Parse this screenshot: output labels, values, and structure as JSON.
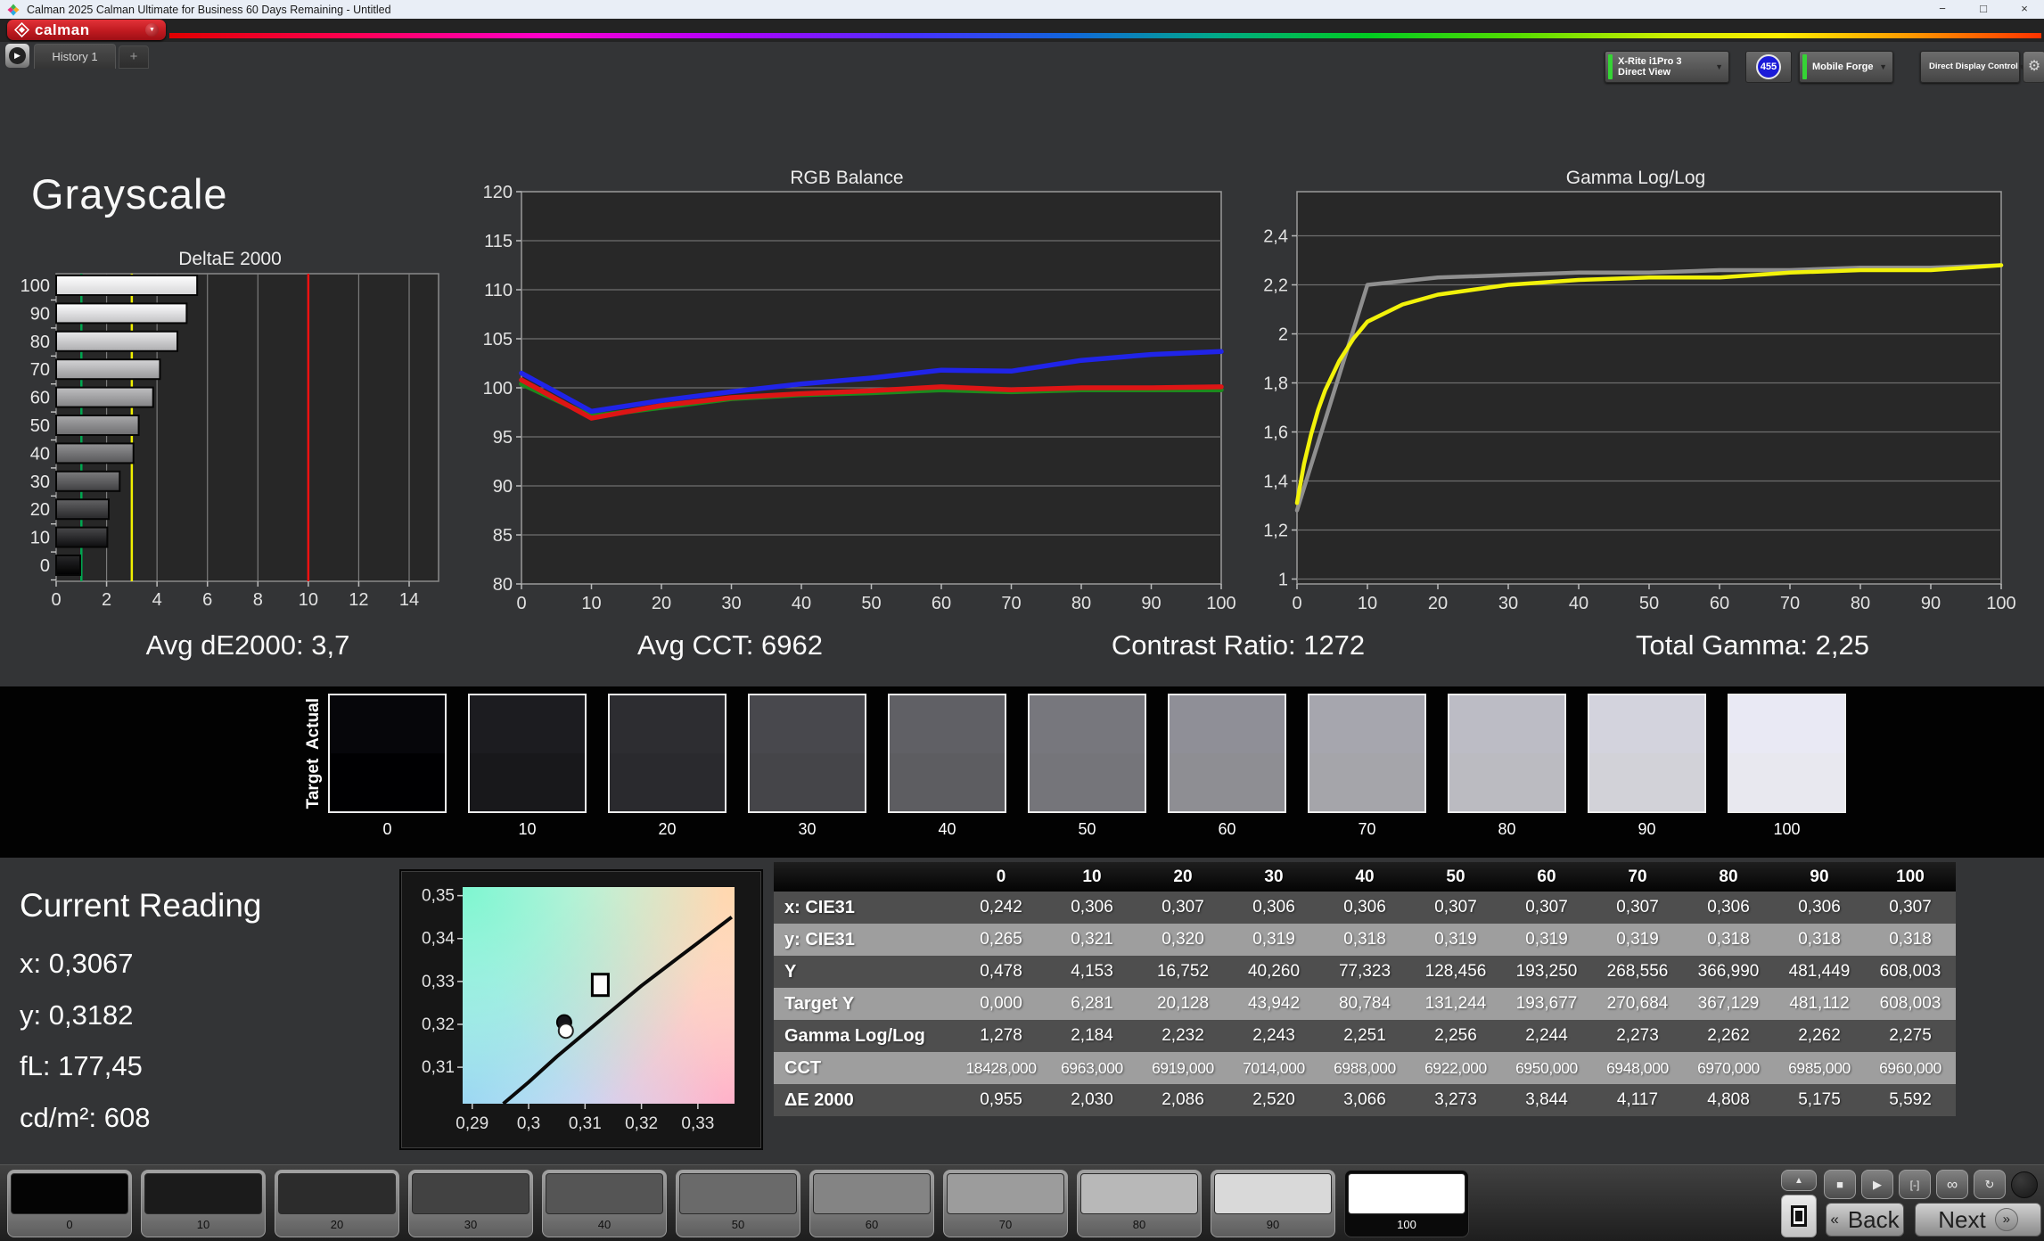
{
  "window": {
    "title": "Calman 2025 Calman Ultimate for Business 60 Days Remaining  - Untitled",
    "minimize": "−",
    "maximize": "□",
    "close": "×"
  },
  "brand": {
    "logo": "calman"
  },
  "nav": {
    "run_glyph": "▶",
    "history_tab": "History 1",
    "add_tab": "+"
  },
  "toolbar": {
    "meter": {
      "line1": "X-Rite i1Pro 3",
      "line2": "Direct View",
      "badge": "455",
      "accent": "#35d435",
      "caret": "▼"
    },
    "source": {
      "label": "Mobile Forge",
      "accent": "#35d435",
      "caret": "▼"
    },
    "control": {
      "label": "Direct Display Control",
      "accent": "#e6e22e",
      "caret": "▼"
    },
    "gear_glyph": "⚙",
    "collapse_glyph": "◀"
  },
  "page": {
    "heading": "Grayscale"
  },
  "stats": [
    "Avg dE2000: 3,7",
    "Avg CCT: 6962",
    "Contrast Ratio: 1272",
    "Total Gamma: 2,25"
  ],
  "chart_data": [
    {
      "id": "deltaE",
      "type": "bar",
      "orientation": "horizontal",
      "title": "DeltaE 2000",
      "categories": [
        "100",
        "90",
        "80",
        "70",
        "60",
        "50",
        "40",
        "30",
        "20",
        "10",
        "0"
      ],
      "values": [
        5.592,
        5.175,
        4.808,
        4.117,
        3.844,
        3.273,
        3.066,
        2.52,
        2.086,
        2.03,
        0.955
      ],
      "bar_levels": [
        100,
        90,
        80,
        70,
        60,
        50,
        40,
        30,
        20,
        10,
        0
      ],
      "xlim": [
        0,
        15.2
      ],
      "xticks": [
        0,
        2,
        4,
        6,
        8,
        10,
        12,
        14
      ],
      "ref_lines": [
        {
          "x": 1.0,
          "color": "#00a650",
          "name": "green-threshold"
        },
        {
          "x": 3.0,
          "color": "#f0f000",
          "name": "yellow-threshold"
        },
        {
          "x": 10.0,
          "color": "#ee1111",
          "name": "red-threshold"
        }
      ]
    },
    {
      "id": "rgb",
      "type": "line",
      "title": "RGB Balance",
      "x": [
        0,
        10,
        20,
        30,
        40,
        50,
        60,
        70,
        80,
        90,
        100
      ],
      "ylim": [
        80,
        120
      ],
      "yticks": [
        120,
        115,
        110,
        105,
        100,
        95,
        90,
        85,
        80
      ],
      "series": [
        {
          "name": "Green",
          "color": "#1d8a1d",
          "values": [
            100.4,
            97.1,
            98.0,
            98.9,
            99.3,
            99.5,
            99.8,
            99.6,
            99.8,
            99.8,
            99.8
          ]
        },
        {
          "name": "Red",
          "color": "#dd1515",
          "values": [
            100.8,
            96.9,
            98.2,
            99.0,
            99.4,
            99.7,
            100.1,
            99.8,
            100.0,
            100.0,
            100.1
          ]
        },
        {
          "name": "Blue",
          "color": "#2024e8",
          "values": [
            101.5,
            97.6,
            98.7,
            99.6,
            100.4,
            101.0,
            101.8,
            101.7,
            102.8,
            103.4,
            103.7
          ]
        }
      ]
    },
    {
      "id": "gamma",
      "type": "line",
      "title": "Gamma Log/Log",
      "ylim": [
        0.98,
        2.58
      ],
      "yticks": [
        {
          "v": 2.4,
          "label": "2,4"
        },
        {
          "v": 2.2,
          "label": "2,2"
        },
        {
          "v": 2.0,
          "label": "2"
        },
        {
          "v": 1.8,
          "label": "1,8"
        },
        {
          "v": 1.6,
          "label": "1,6"
        },
        {
          "v": 1.4,
          "label": "1,4"
        },
        {
          "v": 1.2,
          "label": "1,2"
        },
        {
          "v": 1.0,
          "label": "1"
        }
      ],
      "xticks": [
        0,
        10,
        20,
        30,
        40,
        50,
        60,
        70,
        80,
        90,
        100
      ],
      "series": [
        {
          "name": "Target",
          "color": "#8f8f8f",
          "points": [
            [
              0,
              1.28
            ],
            [
              10,
              2.2
            ],
            [
              20,
              2.23
            ],
            [
              30,
              2.24
            ],
            [
              40,
              2.25
            ],
            [
              50,
              2.25
            ],
            [
              60,
              2.26
            ],
            [
              70,
              2.26
            ],
            [
              80,
              2.27
            ],
            [
              90,
              2.27
            ],
            [
              100,
              2.28
            ]
          ]
        },
        {
          "name": "Measured",
          "color": "#f2f20a",
          "points": [
            [
              0,
              1.31
            ],
            [
              1,
              1.47
            ],
            [
              2,
              1.59
            ],
            [
              3,
              1.69
            ],
            [
              4,
              1.77
            ],
            [
              5,
              1.83
            ],
            [
              6,
              1.89
            ],
            [
              8,
              1.98
            ],
            [
              10,
              2.05
            ],
            [
              15,
              2.12
            ],
            [
              20,
              2.16
            ],
            [
              30,
              2.2
            ],
            [
              40,
              2.22
            ],
            [
              50,
              2.23
            ],
            [
              60,
              2.23
            ],
            [
              70,
              2.25
            ],
            [
              80,
              2.26
            ],
            [
              90,
              2.26
            ],
            [
              100,
              2.28
            ]
          ]
        }
      ]
    },
    {
      "id": "cie",
      "type": "scatter",
      "xlim": [
        0.2883,
        0.3365
      ],
      "ylim": [
        0.3015,
        0.352
      ],
      "xticks": [
        {
          "v": 0.29,
          "label": "0,29"
        },
        {
          "v": 0.3,
          "label": "0,3"
        },
        {
          "v": 0.31,
          "label": "0,31"
        },
        {
          "v": 0.32,
          "label": "0,32"
        },
        {
          "v": 0.33,
          "label": "0,33"
        }
      ],
      "yticks": [
        {
          "v": 0.35,
          "label": "0,35"
        },
        {
          "v": 0.34,
          "label": "0,34"
        },
        {
          "v": 0.33,
          "label": "0,33"
        },
        {
          "v": 0.32,
          "label": "0,32"
        },
        {
          "v": 0.31,
          "label": "0,31"
        }
      ],
      "locus": [
        [
          0.2955,
          0.3015
        ],
        [
          0.3,
          0.3065
        ],
        [
          0.305,
          0.3125
        ],
        [
          0.31,
          0.318
        ],
        [
          0.315,
          0.3235
        ],
        [
          0.32,
          0.329
        ],
        [
          0.325,
          0.334
        ],
        [
          0.33,
          0.339
        ],
        [
          0.336,
          0.345
        ]
      ],
      "target_marker": {
        "x": 0.3127,
        "y": 0.3292
      },
      "readings": [
        {
          "x": 0.3063,
          "y": 0.3205,
          "fill": "#15151a",
          "stroke": "#000000"
        },
        {
          "x": 0.3066,
          "y": 0.3185,
          "fill": "#ffffff",
          "stroke": "#222222"
        }
      ]
    }
  ],
  "swatch_strip": {
    "row_labels": [
      "Actual",
      "Target"
    ],
    "items": [
      {
        "label": "0",
        "actual": "#06060a",
        "target": "#000002"
      },
      {
        "label": "10",
        "actual": "#1c1c20",
        "target": "#18181b"
      },
      {
        "label": "20",
        "actual": "#2d2d31",
        "target": "#2a2a2e"
      },
      {
        "label": "30",
        "actual": "#48484d",
        "target": "#454549"
      },
      {
        "label": "40",
        "actual": "#606065",
        "target": "#5d5d61"
      },
      {
        "label": "50",
        "actual": "#77777d",
        "target": "#75757a"
      },
      {
        "label": "60",
        "actual": "#8f8f97",
        "target": "#8e8e93"
      },
      {
        "label": "70",
        "actual": "#a6a6ae",
        "target": "#a5a5aa"
      },
      {
        "label": "80",
        "actual": "#bcbcc5",
        "target": "#bbbbc1"
      },
      {
        "label": "90",
        "actual": "#d3d3dd",
        "target": "#d2d2d8"
      },
      {
        "label": "100",
        "actual": "#e9e9f4",
        "target": "#e8e8ef"
      }
    ]
  },
  "reading": {
    "heading": "Current Reading",
    "lines": [
      "x: 0,3067",
      "y: 0,3182",
      "fL: 177,45",
      "cd/m²: 608"
    ]
  },
  "table": {
    "col_headers": [
      "0",
      "10",
      "20",
      "30",
      "40",
      "50",
      "60",
      "70",
      "80",
      "90",
      "100"
    ],
    "rows": [
      {
        "label": "x: CIE31",
        "shade": "dark",
        "tight": false,
        "values": [
          "0,242",
          "0,306",
          "0,307",
          "0,306",
          "0,306",
          "0,307",
          "0,307",
          "0,307",
          "0,306",
          "0,306",
          "0,307"
        ]
      },
      {
        "label": "y: CIE31",
        "shade": "light",
        "tight": false,
        "values": [
          "0,265",
          "0,321",
          "0,320",
          "0,319",
          "0,318",
          "0,319",
          "0,319",
          "0,319",
          "0,318",
          "0,318",
          "0,318"
        ]
      },
      {
        "label": "Y",
        "shade": "dark",
        "tight": false,
        "values": [
          "0,478",
          "4,153",
          "16,752",
          "40,260",
          "77,323",
          "128,456",
          "193,250",
          "268,556",
          "366,990",
          "481,449",
          "608,003"
        ]
      },
      {
        "label": "Target Y",
        "shade": "light",
        "tight": false,
        "values": [
          "0,000",
          "6,281",
          "20,128",
          "43,942",
          "80,784",
          "131,244",
          "193,677",
          "270,684",
          "367,129",
          "481,112",
          "608,003"
        ]
      },
      {
        "label": "Gamma Log/Log",
        "shade": "dark",
        "tight": false,
        "values": [
          "1,278",
          "2,184",
          "2,232",
          "2,243",
          "2,251",
          "2,256",
          "2,244",
          "2,273",
          "2,262",
          "2,262",
          "2,275"
        ]
      },
      {
        "label": "CCT",
        "shade": "light",
        "tight": true,
        "values": [
          "18428,000",
          "6963,000",
          "6919,000",
          "7014,000",
          "6988,000",
          "6922,000",
          "6950,000",
          "6948,000",
          "6970,000",
          "6985,000",
          "6960,000"
        ]
      },
      {
        "label": "ΔE 2000",
        "shade": "dark",
        "tight": false,
        "values": [
          "0,955",
          "2,030",
          "2,086",
          "2,520",
          "3,066",
          "3,273",
          "3,844",
          "4,117",
          "4,808",
          "5,175",
          "5,592"
        ]
      }
    ]
  },
  "bottom_bar": {
    "swatches": [
      {
        "label": "0",
        "color": "#040404",
        "selected": false
      },
      {
        "label": "10",
        "color": "#1b1b1b",
        "selected": false
      },
      {
        "label": "20",
        "color": "#2c2c2c",
        "selected": false
      },
      {
        "label": "30",
        "color": "#424242",
        "selected": false
      },
      {
        "label": "40",
        "color": "#555555",
        "selected": false
      },
      {
        "label": "50",
        "color": "#6a6a6a",
        "selected": false
      },
      {
        "label": "60",
        "color": "#848484",
        "selected": false
      },
      {
        "label": "70",
        "color": "#9c9c9c",
        "selected": false
      },
      {
        "label": "80",
        "color": "#b8b8b8",
        "selected": false
      },
      {
        "label": "90",
        "color": "#d9d9d9",
        "selected": false
      },
      {
        "label": "100",
        "color": "#ffffff",
        "selected": true
      }
    ],
    "up_glyph": "▲",
    "icons": [
      {
        "name": "stop-icon",
        "glyph": "■"
      },
      {
        "name": "play-icon",
        "glyph": "▶"
      },
      {
        "name": "interval-icon",
        "glyph": "[-]"
      },
      {
        "name": "continuous-icon",
        "glyph": "∞"
      },
      {
        "name": "refresh-icon",
        "glyph": "↻"
      }
    ],
    "back_glyph": "«",
    "back_label": "Back",
    "next_label": "Next",
    "next_glyph": "»"
  }
}
